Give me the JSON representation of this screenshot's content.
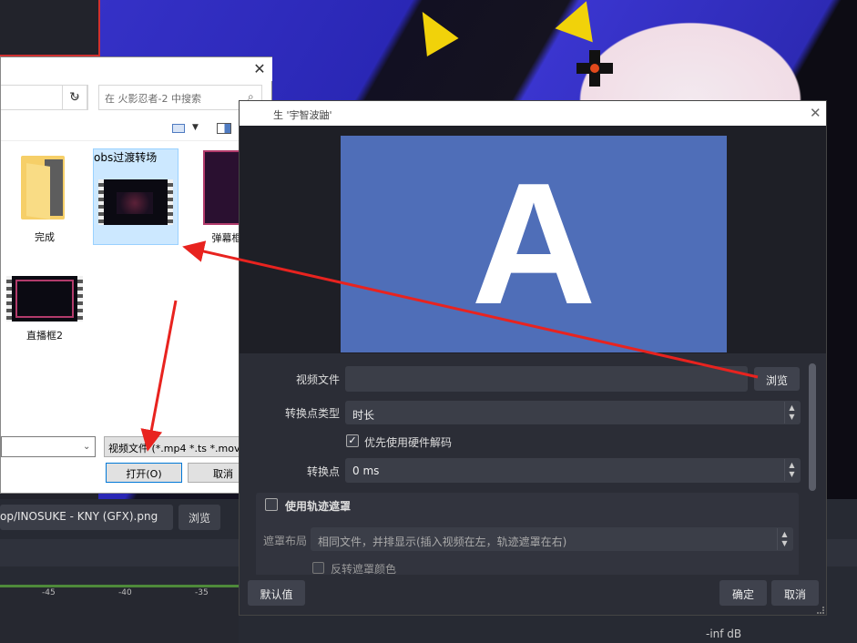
{
  "background": {
    "source_path": "op/INOSUKE - KNY (GFX).png",
    "browse_label": "浏览",
    "mixer_ticks": [
      "-45",
      "-40",
      "-35"
    ],
    "volume_readout": "-inf dB"
  },
  "file_dialog": {
    "search_placeholder": "在 火影忍者-2 中搜索",
    "items": [
      {
        "name": "完成",
        "type": "folder"
      },
      {
        "name": "obs过渡转场",
        "type": "video",
        "selected": true
      },
      {
        "name": "弹幕框",
        "type": "video"
      },
      {
        "name": "直播框2",
        "type": "video"
      }
    ],
    "filename_value": "",
    "filetype_value": "视频文件 (*.mp4 *.ts *.mov *.",
    "open_label": "打开(O)",
    "cancel_label": "取消",
    "help_icon_text": "?"
  },
  "properties_dialog": {
    "title": "生 '宇智波鼬'",
    "preview_glyph": "A",
    "video_file_label": "视频文件",
    "video_file_value": "",
    "browse_label": "浏览",
    "transition_point_type_label": "转换点类型",
    "transition_point_type_value": "时长",
    "hw_decode_label": "优先使用硬件解码",
    "hw_decode_checked": true,
    "transition_point_label": "转换点",
    "transition_point_value": "0 ms",
    "use_track_matte_label": "使用轨迹遮罩",
    "matte_layout_label": "遮罩布局",
    "matte_layout_value": "相同文件，并排显示(插入视频在左，轨迹遮罩在右)",
    "invert_matte_label": "反转遮罩颜色",
    "defaults_label": "默认值",
    "ok_label": "确定",
    "cancel_label": "取消"
  },
  "colors": {
    "arrow": "#e8231f",
    "preview_blue": "#4f6eb8",
    "selection": "#cce8ff",
    "dark_panel": "#2b2d36"
  }
}
